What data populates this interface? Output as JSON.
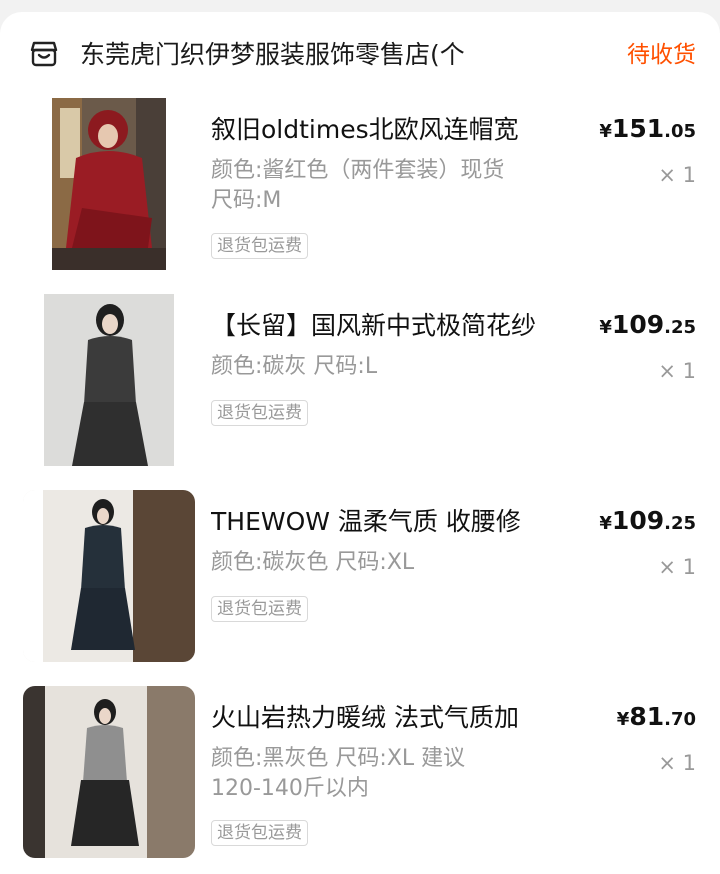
{
  "store": {
    "name": "东莞虎门织伊梦服装服饰零售店(个",
    "status": "待收货"
  },
  "items": [
    {
      "title": "叙旧oldtimes北欧风连帽宽",
      "spec1": "颜色:酱红色（两件套装）现货",
      "spec2": "尺码:M",
      "tag": "退货包运费",
      "price_currency": "¥",
      "price_int": "151",
      "price_dec": ".05",
      "qty": "× 1"
    },
    {
      "title": "【长留】国风新中式极简花纱",
      "spec1": "颜色:碳灰 尺码:L",
      "spec2": "",
      "tag": "退货包运费",
      "price_currency": "¥",
      "price_int": "109",
      "price_dec": ".25",
      "qty": "× 1"
    },
    {
      "title": "THEWOW 温柔气质 收腰修",
      "spec1": "颜色:碳灰色 尺码:XL",
      "spec2": "",
      "tag": "退货包运费",
      "price_currency": "¥",
      "price_int": "109",
      "price_dec": ".25",
      "qty": "× 1"
    },
    {
      "title": "火山岩热力暖绒 法式气质加",
      "spec1": "颜色:黑灰色 尺码:XL 建议",
      "spec2": "120-140斤以内",
      "tag": "退货包运费",
      "price_currency": "¥",
      "price_int": "81",
      "price_dec": ".70",
      "qty": "× 1"
    }
  ],
  "colors": {
    "accent": "#ff5000",
    "muted": "#999999"
  },
  "icons": {
    "store": "store-icon"
  }
}
